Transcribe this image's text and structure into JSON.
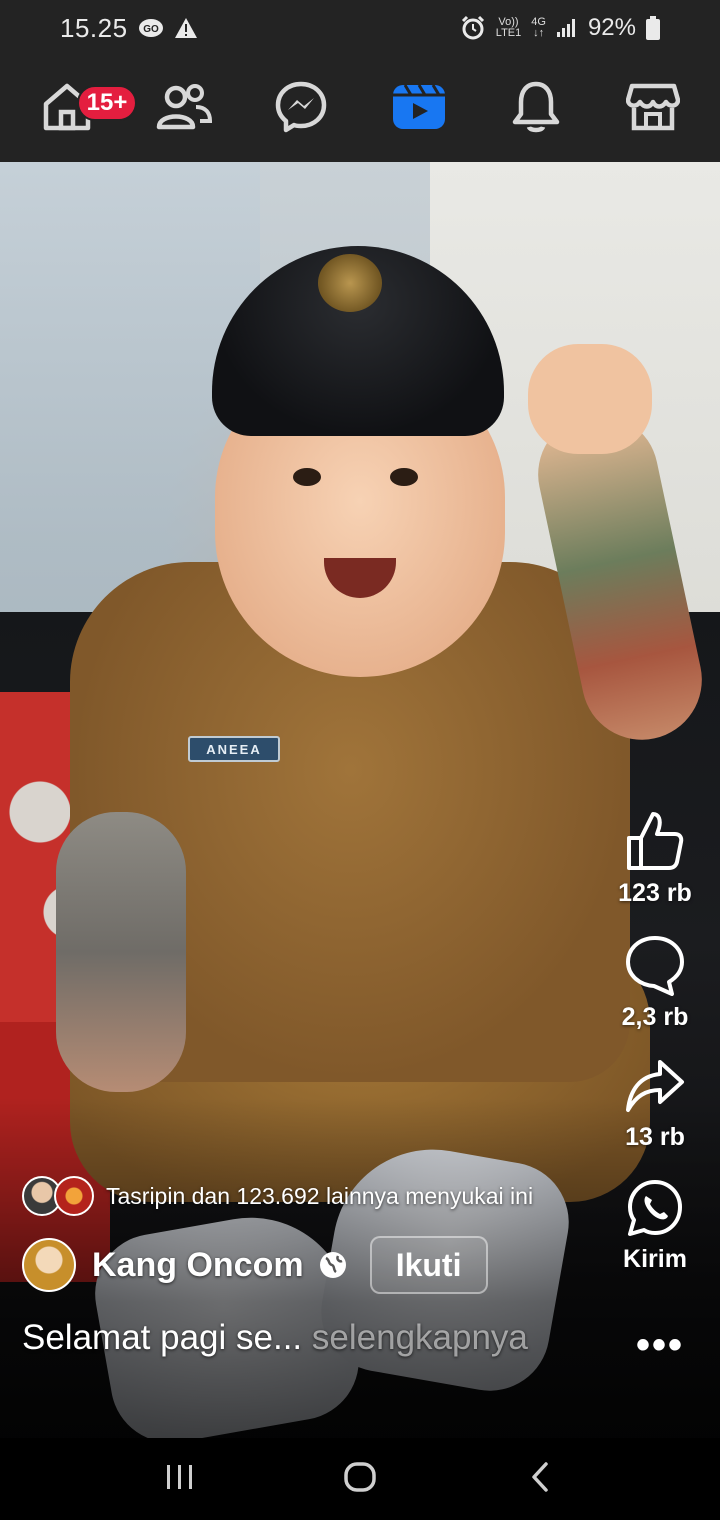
{
  "status_bar": {
    "time": "15.25",
    "network_top": "Vo))",
    "network_bottom": "LTE1",
    "network_type": "4G",
    "battery": "92%"
  },
  "top_nav": {
    "items": [
      {
        "name": "home",
        "icon": "home-icon",
        "badge": "15+"
      },
      {
        "name": "friends",
        "icon": "friends-icon"
      },
      {
        "name": "messenger",
        "icon": "messenger-icon"
      },
      {
        "name": "video",
        "icon": "video-icon",
        "active": true
      },
      {
        "name": "notifications",
        "icon": "bell-icon"
      },
      {
        "name": "marketplace",
        "icon": "store-icon"
      }
    ],
    "active_color": "#1877f2"
  },
  "video": {
    "name_tag": "ANEEA"
  },
  "actions": {
    "like": {
      "label": "123 rb",
      "icon": "thumbs-up-icon"
    },
    "comment": {
      "label": "2,3 rb",
      "icon": "comment-icon"
    },
    "share": {
      "label": "13 rb",
      "icon": "share-icon"
    },
    "send": {
      "label": "Kirim",
      "icon": "whatsapp-icon"
    }
  },
  "post": {
    "likes_text": "Tasripin dan 123.692 lainnya menyukai ini",
    "author": "Kang Oncom",
    "follow_label": "Ikuti",
    "caption": "Selamat pagi se...",
    "see_more": "selengkapnya",
    "more_icon": "more-dots-icon"
  },
  "system_nav": {
    "recents": "recents-icon",
    "home": "home-circle-icon",
    "back": "back-chevron-icon"
  }
}
